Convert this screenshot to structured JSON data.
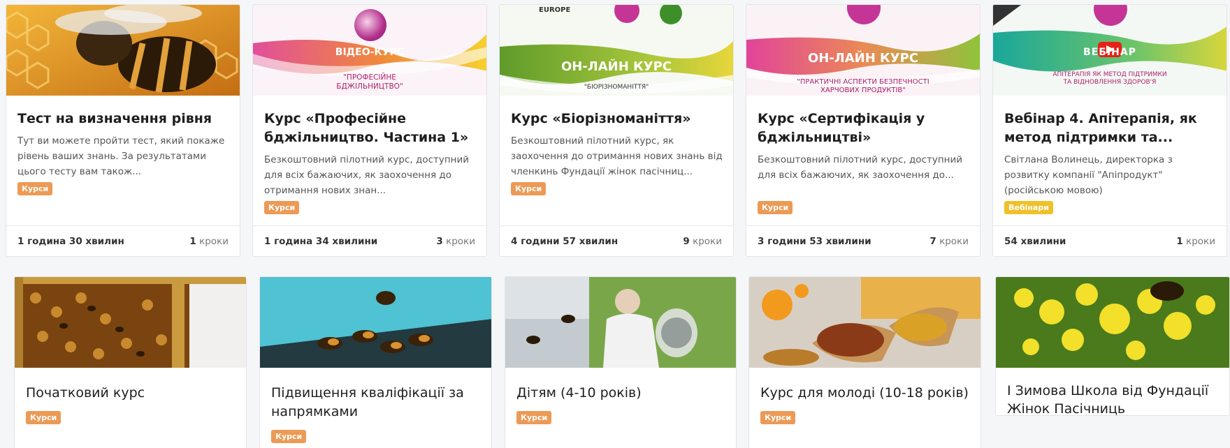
{
  "cards": [
    {
      "title": "Тест на визначення рівня",
      "desc": "Тут ви можете пройти тест, який покаже рівень ваших знань. За результатами цього тесту вам також...",
      "badge": "Курси",
      "duration": "1 година 30 хвилин",
      "steps_num": "1",
      "steps_label": "кроки",
      "image": "bee-on-honeycomb-photo"
    },
    {
      "title": "Курс «Професійне бджільництво. Частина 1»",
      "desc": "Безкоштовний пілотний курс, доступний для всіх бажаючих, як заохочення до отримання нових знан...",
      "badge": "Курси",
      "duration": "1 година 34 хвилини",
      "steps_num": "3",
      "steps_label": "кроки",
      "image": "video-course-banner",
      "banner": {
        "heading": "ВІДЕО-КУРС",
        "sub": "\"ПРОФЕСІЙНЕ БДЖІЛЬНИЦТВО\""
      }
    },
    {
      "title": "Курс «Біорізноманіття»",
      "desc": "Безкоштовний пілотний курс, як заохочення до отримання нових знань від членкинь Фундації жінок пасічниц...",
      "badge": "Курси",
      "duration": "4 години 57 хвилин",
      "steps_num": "9",
      "steps_label": "кроки",
      "image": "online-course-banner-green",
      "banner": {
        "heading": "ОН-ЛАЙН КУРС",
        "sub": "\"БІОРІЗНОМАНІТТЯ\"",
        "top": "EUROPE"
      }
    },
    {
      "title": "Курс «Сертифікація у бджільництві»",
      "desc": "Безкоштовний пілотний курс, доступний для всіх бажаючих, як заохочення до...",
      "badge": "Курси",
      "duration": "3 години 53 хвилини",
      "steps_num": "7",
      "steps_label": "кроки",
      "image": "online-course-banner-pink",
      "banner": {
        "heading": "ОН-ЛАЙН КУРС",
        "sub": "\"ПРАКТИЧНІ АСПЕКТИ БЕЗПЕЧНОСТІ ХАРЧОВИХ ПРОДУКТІВ\""
      }
    },
    {
      "title": "Вебінар 4. Апітерапія, як метод підтримки та...",
      "desc": "Світлана Волинець, директорка з розвитку компанії \"Апіпродукт\" (російською мовою)",
      "badge": "Вебінари",
      "duration": "54 хвилини",
      "steps_num": "1",
      "steps_label": "кроки",
      "image": "webinar-banner",
      "banner": {
        "heading": "ВЕБІНАР",
        "sub": "АПІТЕРАПІЯ ЯК МЕТОД ПІДТРИМКИ ТА ВІДНОВЛЕННЯ ЗДОРОВ'Я"
      }
    },
    {
      "title": "Початковий курс",
      "badge": "Курси",
      "image": "beehive-frame-photo"
    },
    {
      "title": "Підвищення кваліфікації за напрямками",
      "badge": "Курси",
      "image": "bees-at-hive-entrance-photo"
    },
    {
      "title": "Дітям (4-10 років)",
      "badge": "Курси",
      "image": "child-beekeeper-photo"
    },
    {
      "title": "Курс для молоді (10-18 років)",
      "badge": "Курси",
      "image": "bee-pollen-scoop-photo"
    },
    {
      "title": "І Зимова Школа від Фундації Жінок Пасічниць",
      "image": "bee-on-yellow-flower-photo"
    }
  ],
  "colors": {
    "badge_courses": "#ec9a55",
    "badge_webinars": "#f0c02a"
  }
}
